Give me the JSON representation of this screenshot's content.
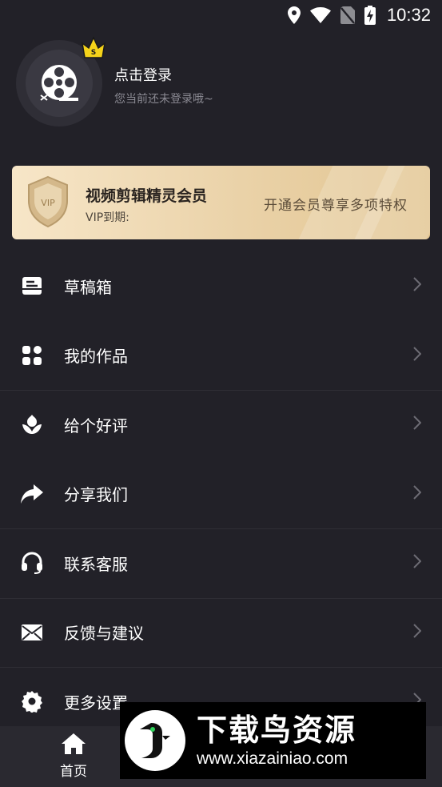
{
  "status_bar": {
    "time": "10:32",
    "icons": [
      "location-icon",
      "wifi-icon",
      "no-sim-icon",
      "battery-charging-icon"
    ]
  },
  "profile": {
    "login_title": "点击登录",
    "login_subtitle": "您当前还未登录哦~",
    "avatar_icon": "film-reel-icon",
    "crown_icon": "crown-icon"
  },
  "vip": {
    "title": "视频剪辑精灵会员",
    "expire_label": "VIP到期:",
    "cta": "开通会员尊享多项特权",
    "badge_text": "VIP"
  },
  "menu": [
    {
      "label": "草稿箱",
      "icon": "drafts-box-icon"
    },
    {
      "label": "我的作品",
      "icon": "works-grid-icon"
    },
    {
      "label": "给个好评",
      "icon": "flower-rating-icon"
    },
    {
      "label": "分享我们",
      "icon": "share-arrow-icon"
    },
    {
      "label": "联系客服",
      "icon": "headset-icon"
    },
    {
      "label": "反馈与建议",
      "icon": "mail-icon"
    },
    {
      "label": "更多设置",
      "icon": "gear-icon"
    }
  ],
  "bottom_nav": {
    "home_label": "首页"
  },
  "watermark": {
    "title": "下载鸟资源",
    "url": "www.xiazainiao.com"
  },
  "colors": {
    "background": "#222128",
    "vip_gold": "#ead2a8",
    "crown_yellow": "#f5d31a"
  }
}
